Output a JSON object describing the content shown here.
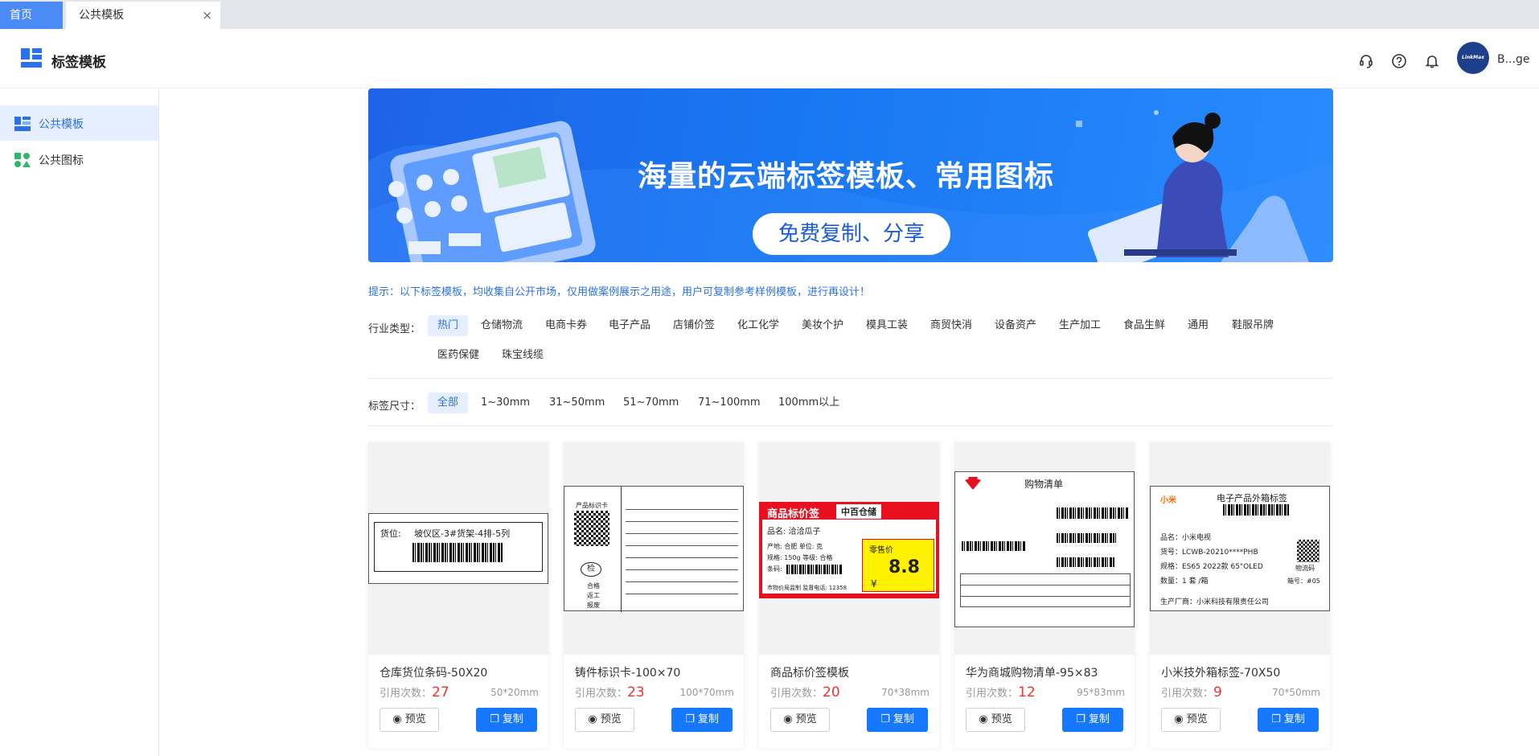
{
  "tabs": {
    "home": "首页",
    "current": "公共模板",
    "close": "×"
  },
  "header": {
    "title": "标签模板",
    "username": "B...ge",
    "avatar_text": "LinkMax"
  },
  "sidebar": {
    "items": [
      {
        "label": "公共模板",
        "icon": "template-grid-icon"
      },
      {
        "label": "公共图标",
        "icon": "shapes-icon"
      }
    ]
  },
  "banner": {
    "title": "海量的云端标签模板、常用图标",
    "pill": "免费复制、分享"
  },
  "tip": "提示：以下标签模板，均收集自公开市场，仅用做案例展示之用途，用户可复制参考样例模板，进行再设计！",
  "industry": {
    "label": "行业类型：",
    "options": [
      "热门",
      "仓储物流",
      "电商卡券",
      "电子产品",
      "店铺价签",
      "化工化学",
      "美妆个护",
      "模具工装",
      "商贸快消",
      "设备资产",
      "生产加工",
      "食品生鲜",
      "通用",
      "鞋服吊牌",
      "医药保健",
      "珠宝线缆"
    ],
    "selected": "热门"
  },
  "size_filter": {
    "label": "标签尺寸：",
    "options": [
      "全部",
      "1~30mm",
      "31~50mm",
      "51~70mm",
      "71~100mm",
      "100mm以上"
    ],
    "selected": "全部"
  },
  "cards": [
    {
      "name": "仓库货位条码-50X20",
      "cite_label": "引用次数：",
      "count": "27",
      "size": "50*20mm",
      "preview_btn": "预览",
      "copy_btn": "复制",
      "preview_text": {
        "field": "货位:",
        "value": "坡仪区-3#货架-4排-5列"
      }
    },
    {
      "name": "铸件标识卡-100×70",
      "cite_label": "引用次数：",
      "count": "23",
      "size": "100*70mm",
      "preview_btn": "预览",
      "copy_btn": "复制",
      "preview_text": {
        "badge": "检",
        "items": [
          "合格",
          "返工",
          "报废"
        ],
        "head": "产品标识卡"
      }
    },
    {
      "name": "商品标价签模板",
      "cite_label": "引用次数：",
      "count": "20",
      "size": "70*38mm",
      "preview_btn": "预览",
      "copy_btn": "复制",
      "preview_text": {
        "title": "商品标价签",
        "store": "中百仓储",
        "product": "品名: 洽洽瓜子",
        "origin": "产地: 合肥  单位: 克",
        "spec": "规格: 150g 等级: 合格",
        "code": "条码:",
        "price_label": "零售价",
        "price": "8.8",
        "currency": "¥",
        "footer": "市物价局监制 监督电话: 12358"
      }
    },
    {
      "name": "华为商城购物清单-95×83",
      "cite_label": "引用次数：",
      "count": "12",
      "size": "95*83mm",
      "preview_btn": "预览",
      "copy_btn": "复制",
      "preview_text": {
        "title": "购物清单",
        "brand": "HUAWEI"
      }
    },
    {
      "name": "小米技外箱标签-70X50",
      "cite_label": "引用次数：",
      "count": "9",
      "size": "70*50mm",
      "preview_btn": "预览",
      "copy_btn": "复制",
      "preview_text": {
        "title": "电子产品外箱标签",
        "brand": "小米",
        "l1": "品名：小米电视",
        "l2": "货号：LCWB-20210****PHB",
        "l3": "规格：ES65 2022款 65\"OLED",
        "l4": "数量：1  套 /箱",
        "box": "箱号：#05",
        "maker": "生产厂商：小米科技有限责任公司",
        "qr": "物流码"
      }
    }
  ],
  "colors": {
    "accent": "#1677ff",
    "count": "#ee3333",
    "banner": "#1877f2"
  }
}
